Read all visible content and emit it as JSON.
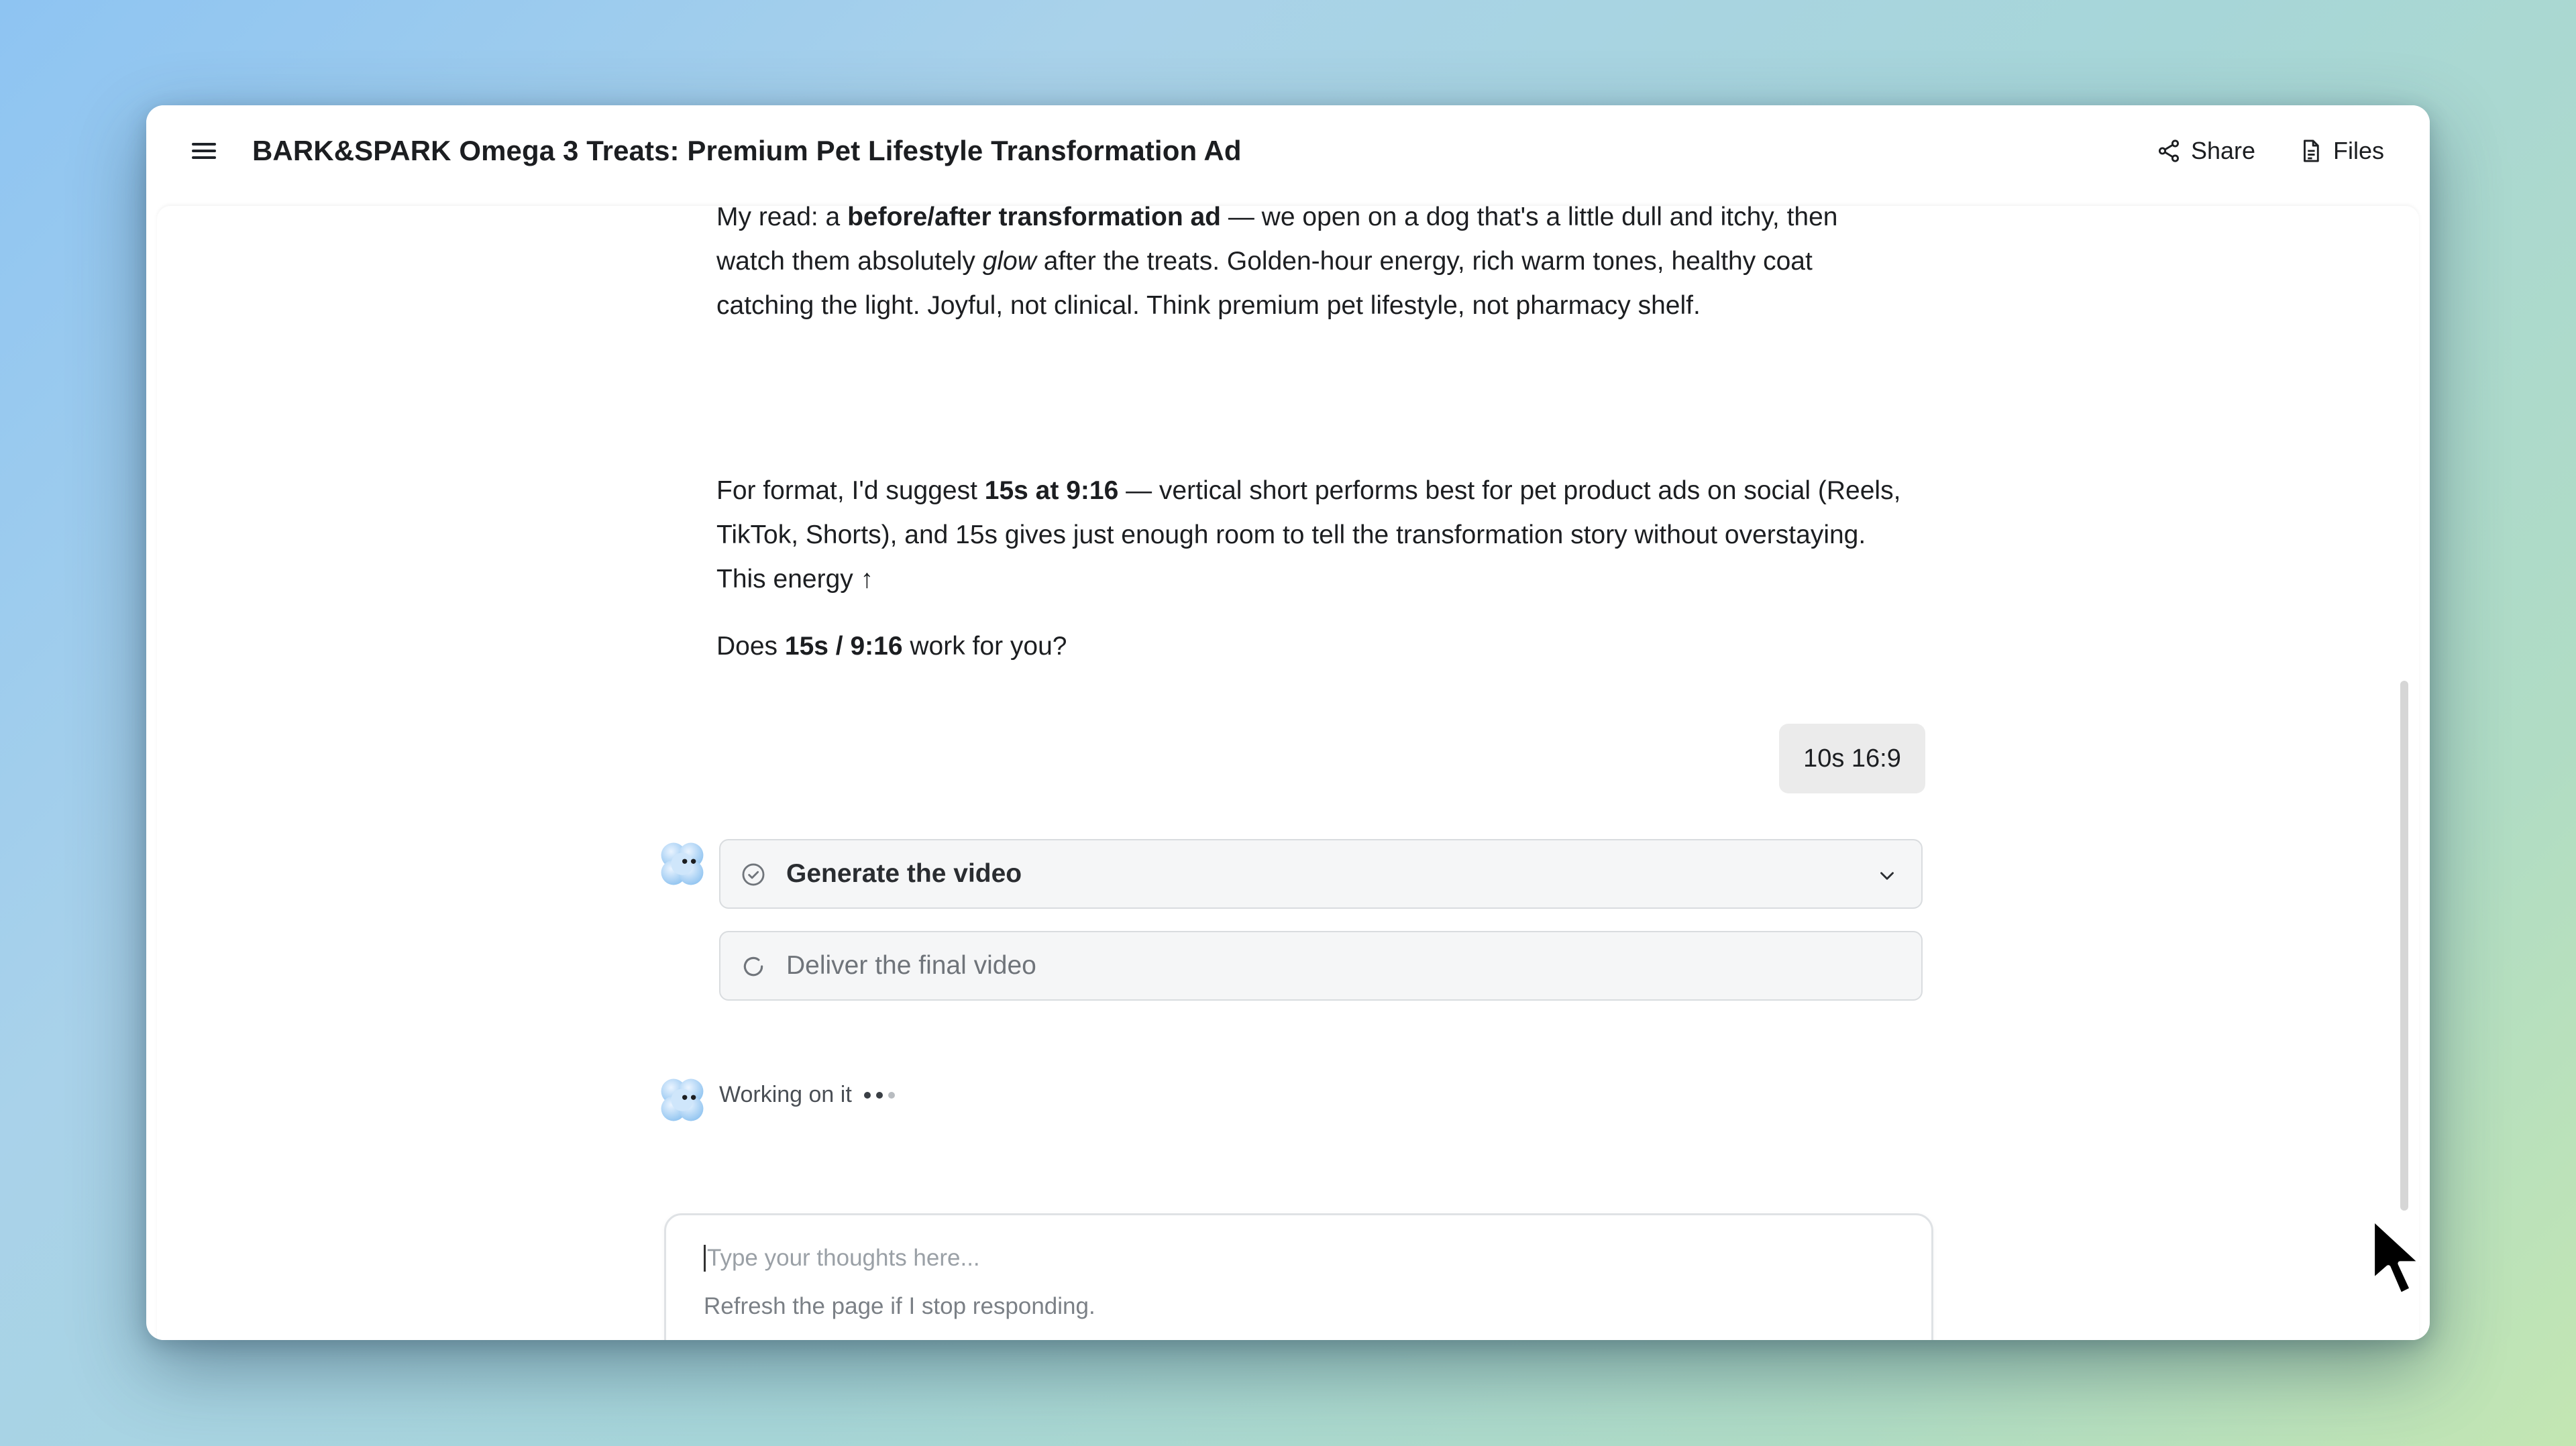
{
  "window": {
    "title": "BARK&SPARK Omega 3 Treats: Premium Pet Lifestyle Transformation Ad",
    "share_label": "Share",
    "files_label": "Files",
    "icons": {
      "menu": "hamburger-menu-icon",
      "share": "share-icon",
      "files": "file-icon"
    }
  },
  "conversation": {
    "assistant_paragraph_1": {
      "s1": "My read: a ",
      "b1": "before/after transformation ad",
      "s2": " — we open on a dog that's a little dull and itchy, then watch them absolutely ",
      "i1": "glow",
      "s3": " after the treats. Golden-hour energy, rich warm tones, healthy coat catching the light. Joyful, not clinical. Think premium pet lifestyle, not pharmacy shelf."
    },
    "assistant_paragraph_2": {
      "s1": "For format, I'd suggest ",
      "b1": "15s at 9:16",
      "s2": " — vertical short performs best for pet product ads on social (Reels, TikTok, Shorts), and 15s gives just enough room to tell the transformation story without overstaying. This energy ↑"
    },
    "assistant_paragraph_3": {
      "s1": "Does ",
      "b1": "15s / 9:16",
      "s2": " work for you?"
    },
    "user_message": "10s 16:9",
    "tasks": [
      {
        "label": "Generate the video",
        "status": "done",
        "icon": "check-circle-icon",
        "expandable": true
      },
      {
        "label": "Deliver the final video",
        "status": "in-progress",
        "icon": "spinner-icon",
        "expandable": false
      }
    ],
    "working_status": "Working on it"
  },
  "composer": {
    "placeholder": "Type your thoughts here...",
    "hint": "Refresh the page if I stop responding.",
    "add_icon": "plus-icon",
    "send_icon": "loading-icon"
  },
  "colors": {
    "background_gradient": [
      "#8ec4f2",
      "#c3e6b2"
    ],
    "user_bubble": "#ebebeb",
    "task_bg": "#f5f6f7",
    "text": "#1c1e21"
  }
}
